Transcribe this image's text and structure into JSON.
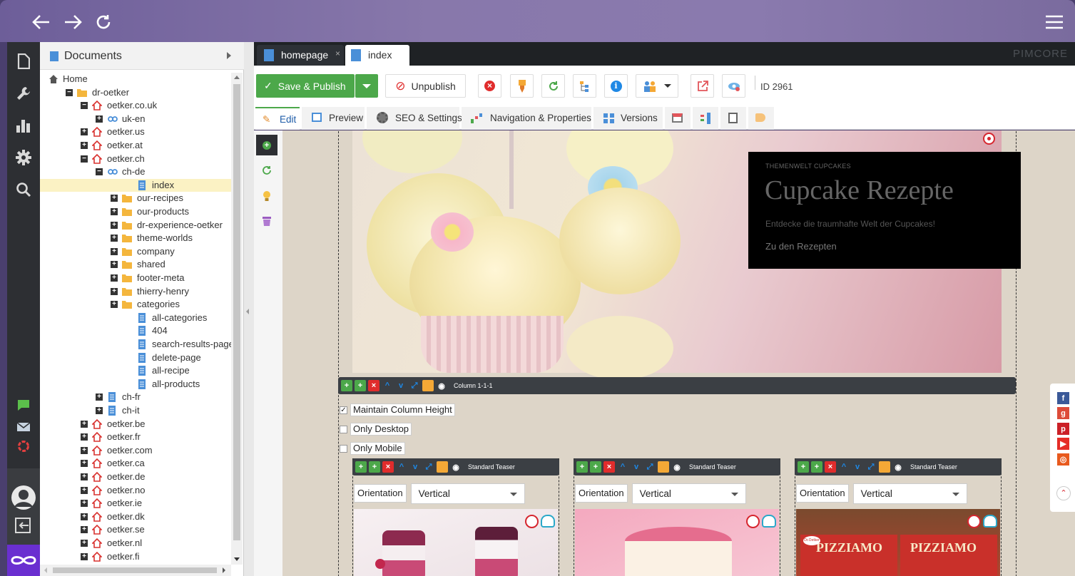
{
  "tree": {
    "title": "Documents",
    "nodes": [
      {
        "label": "Home"
      },
      {
        "label": "dr-oetker"
      },
      {
        "label": "oetker.co.uk"
      },
      {
        "label": "uk-en"
      },
      {
        "label": "oetker.us"
      },
      {
        "label": "oetker.at"
      },
      {
        "label": "oetker.ch"
      },
      {
        "label": "ch-de"
      },
      {
        "label": "index"
      },
      {
        "label": "our-recipes"
      },
      {
        "label": "our-products"
      },
      {
        "label": "dr-experience-oetker"
      },
      {
        "label": "theme-worlds"
      },
      {
        "label": "company"
      },
      {
        "label": "shared"
      },
      {
        "label": "footer-meta"
      },
      {
        "label": "thierry-henry"
      },
      {
        "label": "categories"
      },
      {
        "label": "all-categories"
      },
      {
        "label": "404"
      },
      {
        "label": "search-results-page"
      },
      {
        "label": "delete-page"
      },
      {
        "label": "all-recipe"
      },
      {
        "label": "all-products"
      },
      {
        "label": "ch-fr"
      },
      {
        "label": "ch-it"
      },
      {
        "label": "oetker.be"
      },
      {
        "label": "oetker.fr"
      },
      {
        "label": "oetker.com"
      },
      {
        "label": "oetker.ca"
      },
      {
        "label": "oetker.de"
      },
      {
        "label": "oetker.no"
      },
      {
        "label": "oetker.ie"
      },
      {
        "label": "oetker.dk"
      },
      {
        "label": "oetker.se"
      },
      {
        "label": "oetker.nl"
      },
      {
        "label": "oetker.fi"
      }
    ]
  },
  "tabs": {
    "homepage": "homepage",
    "index": "index",
    "close": "×",
    "brand": "PIMCORE"
  },
  "toolbar": {
    "save_publish": "Save & Publish",
    "unpublish": "Unpublish",
    "id_label": "ID 2961"
  },
  "subtabs": {
    "edit": "Edit",
    "preview": "Preview",
    "seo": "SEO & Settings",
    "navigation": "Navigation & Properties",
    "versions": "Versions"
  },
  "hero": {
    "kicker": "THEMENWELT CUPCAKES",
    "title": "Cupcake Rezepte",
    "subtitle": "Entdecke die traumhafte Welt der Cupcakes!",
    "link": "Zu den Rezepten"
  },
  "column_bar": {
    "label": "Column 1-1-1"
  },
  "options": {
    "maintain": "Maintain Column Height",
    "desktop": "Only Desktop",
    "mobile": "Only Mobile",
    "maintain_checked": true
  },
  "teasers": [
    {
      "bar_label": "Standard Teaser",
      "orientation_label": "Orientation",
      "orientation_value": "Vertical"
    },
    {
      "bar_label": "Standard Teaser",
      "orientation_label": "Orientation",
      "orientation_value": "Vertical"
    },
    {
      "bar_label": "Standard Teaser",
      "orientation_label": "Orientation",
      "orientation_value": "Vertical"
    }
  ],
  "pizza_text": "PIZZIAMO",
  "pizza_brand": "Dr.Oetker",
  "colors": {
    "accent_green": "#4ca84a",
    "rail": "#2d2f33",
    "tabbar": "#1f2225",
    "topbar": "#8878ab",
    "logo_purple": "#6a2fd0"
  }
}
